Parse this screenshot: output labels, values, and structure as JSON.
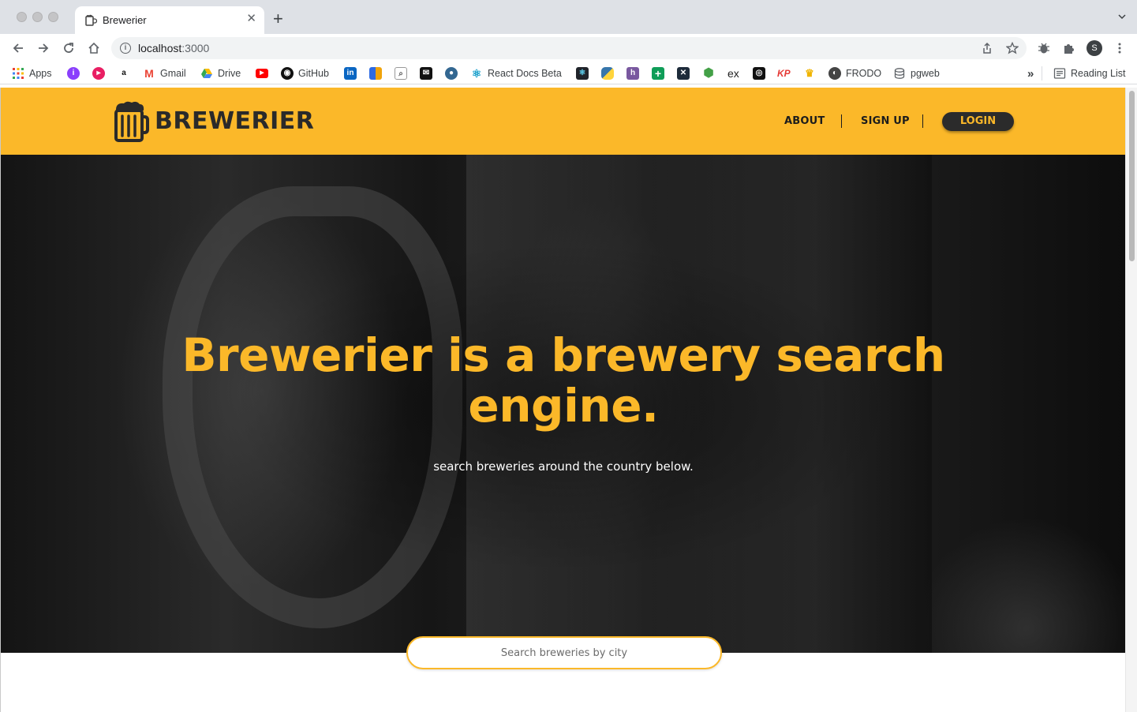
{
  "browser": {
    "tab_title": "Brewerier",
    "url_host": "localhost",
    "url_port": ":3000",
    "profile_initial": "S",
    "bookmarks": {
      "apps": "Apps",
      "gmail": "Gmail",
      "drive": "Drive",
      "github": "GitHub",
      "react_docs": "React Docs Beta",
      "ex": "ex",
      "kp": "KP",
      "frodo": "FRODO",
      "pgweb": "pgweb",
      "overflow": "»",
      "reading_list": "Reading List"
    }
  },
  "site": {
    "brand": "BREWERIER",
    "nav": {
      "about": "ABOUT",
      "signup": "SIGN UP",
      "login": "LOGIN"
    },
    "hero": {
      "title": "Brewerier is a brewery search engine.",
      "subtitle": "search breweries around the country below."
    },
    "search": {
      "placeholder": "Search breweries by city"
    }
  },
  "colors": {
    "brand_yellow": "#fbb829",
    "dark": "#2b2b2b"
  },
  "icons": [
    "back-icon",
    "forward-icon",
    "reload-icon",
    "home-icon",
    "info-icon",
    "share-icon",
    "star-icon",
    "extension-bug-icon",
    "puzzle-icon",
    "menu-icon",
    "beer-mug-icon"
  ]
}
